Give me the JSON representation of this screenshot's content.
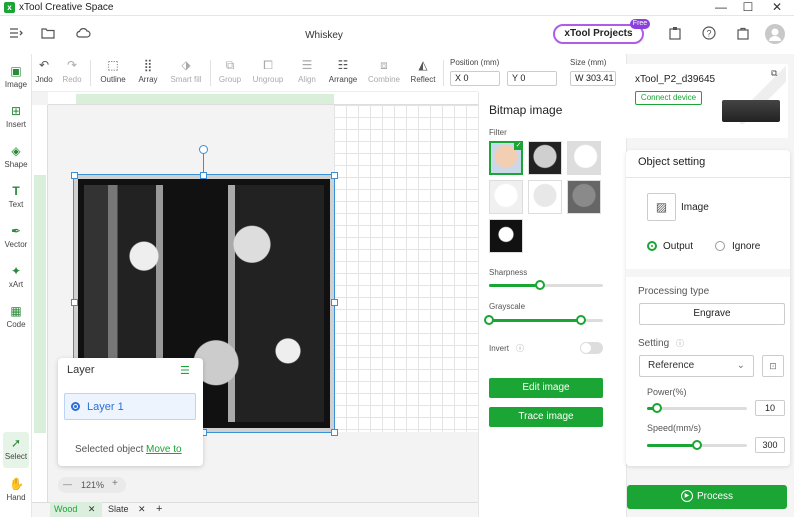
{
  "titlebar": {
    "app_title": "xTool Creative Space",
    "logo_glyph": "x",
    "minimize": "—",
    "maximize": "☐",
    "close": "✕"
  },
  "topbar": {
    "doc_title": "Whiskey",
    "projects_label": "xTool Projects",
    "free_badge": "Free",
    "icons": [
      "menu-icon",
      "folder-icon",
      "cloud-icon",
      "clipboard-icon",
      "help-icon",
      "bag-icon",
      "avatar"
    ]
  },
  "lefttools": [
    {
      "label": "Image",
      "icon": "image-icon"
    },
    {
      "label": "Insert",
      "icon": "insert-icon"
    },
    {
      "label": "Shape",
      "icon": "shape-icon"
    },
    {
      "label": "Text",
      "icon": "text-icon"
    },
    {
      "label": "Vector",
      "icon": "vector-icon"
    },
    {
      "label": "xArt",
      "icon": "xart-icon"
    },
    {
      "label": "Code",
      "icon": "code-icon"
    },
    {
      "label": "Select",
      "icon": "select-icon"
    },
    {
      "label": "Hand",
      "icon": "hand-icon"
    }
  ],
  "actions": {
    "undo": "Jndo",
    "redo": "Redo",
    "outline": "Outline",
    "array": "Array",
    "smart_fill": "Smart fill",
    "group": "Group",
    "ungroup": "Ungroup",
    "align": "Align",
    "arrange": "Arrange",
    "combine": "Combine",
    "reflect": "Reflect"
  },
  "position": {
    "label": "Position (mm)",
    "x": "X 0",
    "y": "Y 0"
  },
  "size": {
    "label": "Size (mm)",
    "w": "W 303.41"
  },
  "layer_panel": {
    "title": "Layer",
    "layer_name": "Layer 1",
    "selected_text": "Selected object",
    "move_to": "Move to"
  },
  "zoom": {
    "minus": "—",
    "value": "121%",
    "plus": "+"
  },
  "tabs": [
    {
      "label": "Wood",
      "close": "✕"
    },
    {
      "label": "Slate",
      "close": "✕"
    }
  ],
  "tab_add": "+",
  "bitmap": {
    "title": "Bitmap image",
    "filter_label": "Filter",
    "sharpness_label": "Sharpness",
    "sharpness_value": 0.45,
    "grayscale_label": "Grayscale",
    "grayscale_min": 0.0,
    "grayscale_max": 0.81,
    "invert_label": "Invert",
    "invert_on": false,
    "edit_button": "Edit image",
    "trace_button": "Trace image"
  },
  "device": {
    "name": "xTool_P2_d39645",
    "connect": "Connect device"
  },
  "object_setting": {
    "title": "Object setting",
    "type_label": "Image",
    "output_label": "Output",
    "ignore_label": "Ignore",
    "processing_type_label": "Processing type",
    "processing_type": "Engrave",
    "setting_label": "Setting",
    "setting_value": "Reference",
    "power_label": "Power(%)",
    "power_value": "10",
    "power_fraction": 0.1,
    "speed_label": "Speed(mm/s)",
    "speed_value": "300",
    "speed_fraction": 0.5
  },
  "process_button": "Process",
  "colors": {
    "accent": "#1aa534",
    "selection": "#3a8fd6",
    "projects_border": "#b25ce6"
  }
}
